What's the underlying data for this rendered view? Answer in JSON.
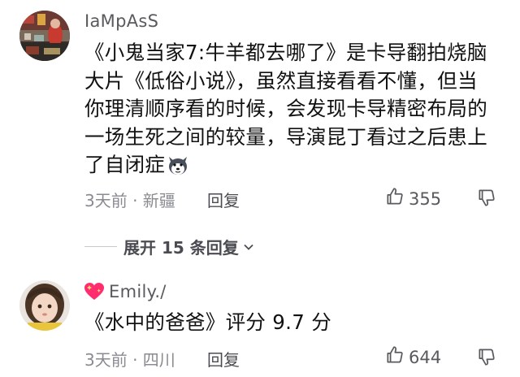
{
  "comments": [
    {
      "username": "IaMpAsS",
      "text": "《小鬼当家7:牛羊都去哪了》是卡导翻拍烧脑大片《低俗小说》，虽然直接看看不懂，但当你理清顺序看的时候，会发现卡导精密布局的一场生死之间的较量，导演昆丁看过之后患上了自闭症",
      "meta": "3天前 · 新疆",
      "reply_label": "回复",
      "likes": "355",
      "emoji_icon": "husky-dog-emoji"
    },
    {
      "username": "Emily./",
      "badge_icon": "sparkling-heart-emoji",
      "text": "《水中的爸爸》评分 9.7 分",
      "meta": "3天前 · 四川",
      "reply_label": "回复",
      "likes": "644"
    }
  ],
  "expand_replies": {
    "label": "展开 15 条回复",
    "icon": "chevron-down-icon"
  },
  "colors": {
    "text": "#111111",
    "secondary": "#8a8b91",
    "heart": "#ff2d6f"
  }
}
